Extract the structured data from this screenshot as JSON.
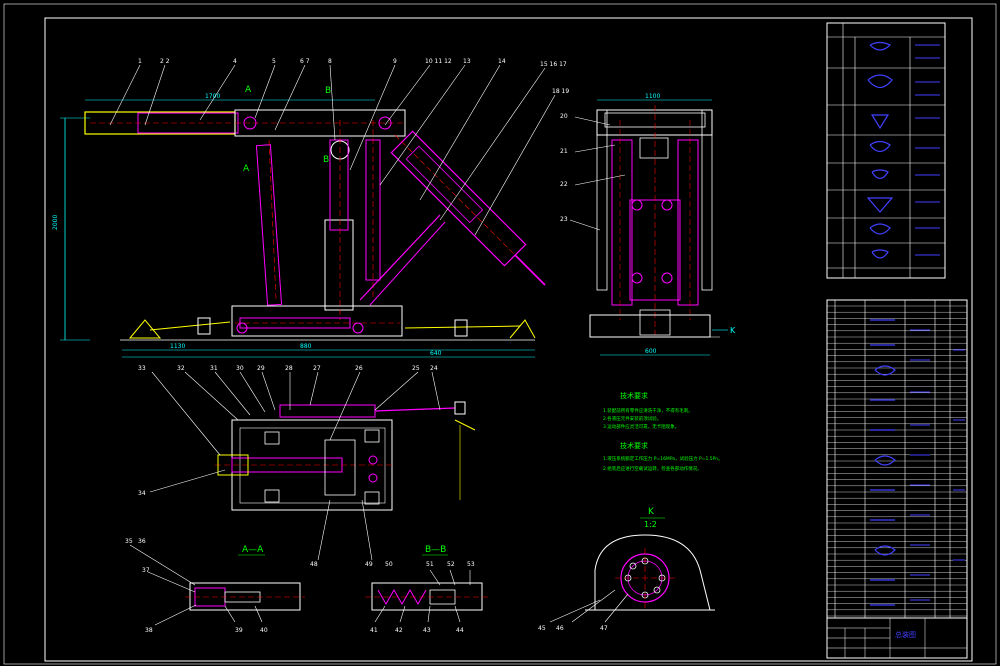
{
  "callouts_top": [
    "1",
    "2 2",
    "4",
    "5",
    "6 7",
    "8",
    "9",
    "10 11 12",
    "13",
    "14",
    "15 16 17",
    "18 19",
    "20",
    "21",
    "22",
    "23"
  ],
  "callouts_plan": [
    "33",
    "32",
    "31",
    "30",
    "29",
    "28",
    "27",
    "26",
    "25",
    "24",
    "34",
    "48",
    "49",
    "50"
  ],
  "callouts_sections": [
    "35",
    "36",
    "37",
    "38",
    "39",
    "40",
    "41",
    "42",
    "43",
    "44",
    "51",
    "52",
    "53",
    "45",
    "46",
    "47"
  ],
  "section_labels": {
    "a_top": "A",
    "a_bottom": "A",
    "b_top": "B",
    "b_bottom": "B",
    "k_marker": "K",
    "aa_title": "A—A",
    "bb_title": "B—B",
    "k_title": "K",
    "k_scale": "1:2"
  },
  "dims": {
    "top_width": "1700",
    "height": "2000",
    "base1": "1130",
    "base2": "880",
    "base3": "640",
    "side_width": "1100",
    "side_base": "600"
  },
  "notes": {
    "title1": "技术要求",
    "title2": "技术要求",
    "lines1": [
      "1.装配前所有零件应清洗干净，不得有毛刺。",
      "2.各液压元件安装前须试验。",
      "3.运动部件应灵活可靠，无卡阻现象。"
    ],
    "lines2": [
      "1.液压系统额定工作压力 P=16MPa，试验压力 P=1.5Pn。",
      "2.组装后应进行空载试运转，检查各部动作情况。"
    ]
  },
  "title_block": {
    "label": "总装图"
  },
  "colors": {
    "frame": "#ffffff",
    "cyan": "#00ffff",
    "magenta": "#ff00ff",
    "yellow": "#ffff00",
    "red": "#ff0000",
    "green": "#00ff00",
    "blue": "#4040ff"
  }
}
